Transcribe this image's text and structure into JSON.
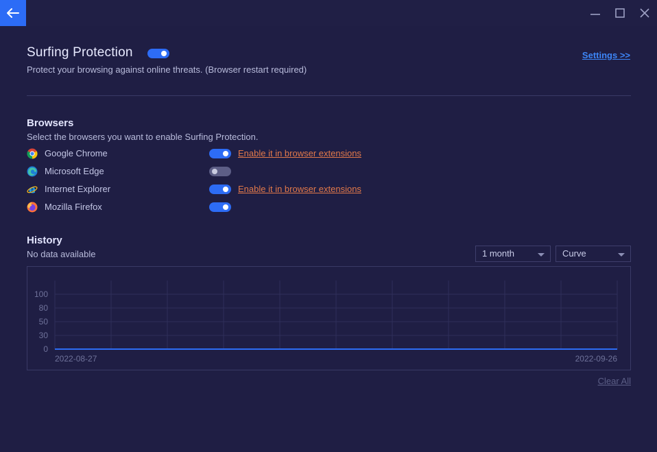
{
  "titlebar": {
    "back_icon": "arrow-left-icon",
    "minimize_icon": "minimize-icon",
    "maximize_icon": "maximize-icon",
    "close_icon": "close-icon",
    "accent_color": "#2c6cf6"
  },
  "protection": {
    "title": "Surfing Protection",
    "enabled": true,
    "description": "Protect your browsing against online threats. (Browser restart required)",
    "settings_link": "Settings >>"
  },
  "browsers": {
    "heading": "Browsers",
    "description": "Select the browsers you want to enable Surfing Protection.",
    "items": [
      {
        "name": "Google Chrome",
        "icon": "chrome-icon",
        "enabled": true,
        "link": "Enable it in browser extensions"
      },
      {
        "name": "Microsoft Edge",
        "icon": "edge-icon",
        "enabled": false,
        "link": ""
      },
      {
        "name": "Internet Explorer",
        "icon": "internet-explorer-icon",
        "enabled": true,
        "link": "Enable it in browser extensions"
      },
      {
        "name": "Mozilla Firefox",
        "icon": "firefox-icon",
        "enabled": true,
        "link": ""
      }
    ],
    "link_color": "#e2794a"
  },
  "history": {
    "heading": "History",
    "status": "No data available",
    "period_select": "1 month",
    "style_select": "Curve",
    "clear_all": "Clear All"
  },
  "chart_data": {
    "type": "line",
    "x": [
      "2022-08-27",
      "2022-09-26"
    ],
    "series": [
      {
        "values": [
          0,
          0
        ]
      }
    ],
    "y_ticks": [
      0,
      30,
      50,
      80,
      100
    ],
    "x_tick_labels": [
      "2022-08-27",
      "2022-09-26"
    ],
    "ylim": [
      0,
      100
    ],
    "grid": true,
    "line_color": "#2d6cf5"
  }
}
